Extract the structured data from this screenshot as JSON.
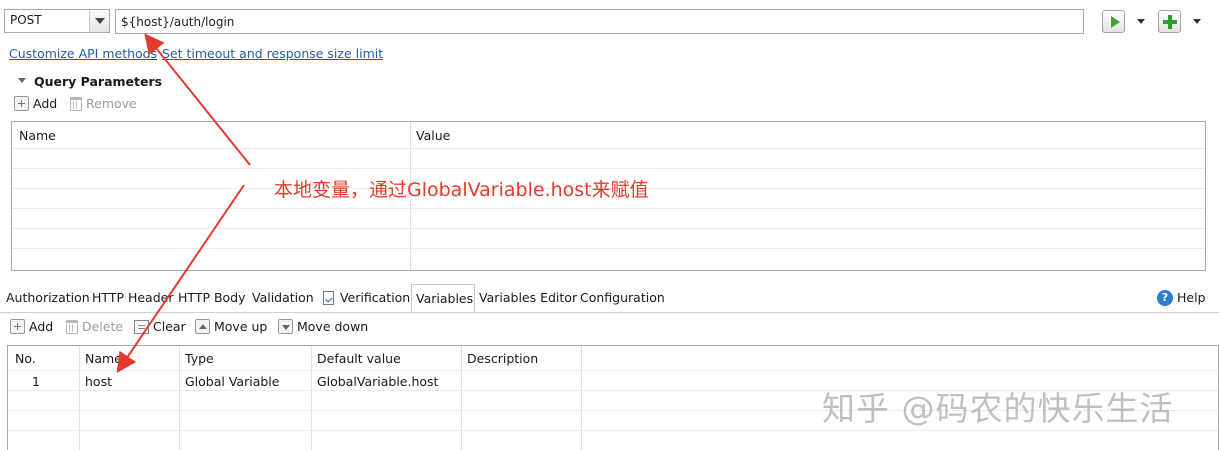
{
  "request": {
    "method": "POST",
    "url": "${host}/auth/login"
  },
  "links": {
    "customize": "Customize API methods",
    "timeout": "Set timeout and response size limit"
  },
  "query_params": {
    "title": "Query Parameters",
    "add_label": "Add",
    "remove_label": "Remove",
    "columns": [
      "Name",
      "Value"
    ]
  },
  "tabs": {
    "items": [
      "Authorization",
      "HTTP Header",
      "HTTP Body",
      "Validation",
      "Verification",
      "Variables",
      "Variables Editor",
      "Configuration"
    ],
    "active": "Variables",
    "help_label": "Help"
  },
  "variables_toolbar": {
    "add": "Add",
    "delete": "Delete",
    "clear": "Clear",
    "move_up": "Move up",
    "move_down": "Move down"
  },
  "variables_table": {
    "columns": [
      "No.",
      "Name",
      "Type",
      "Default value",
      "Description"
    ],
    "rows": [
      {
        "no": "1",
        "name": "host",
        "type": "Global Variable",
        "default": "GlobalVariable.host",
        "description": ""
      }
    ]
  },
  "annotation": {
    "text": "本地变量，通过GlobalVariable.host来赋值",
    "color": "#e53b2e"
  },
  "watermark": "知乎 @码农的快乐生活",
  "colors": {
    "link": "#1f5fa8",
    "run_green": "#3fa535",
    "help_blue": "#2b7cd3"
  }
}
